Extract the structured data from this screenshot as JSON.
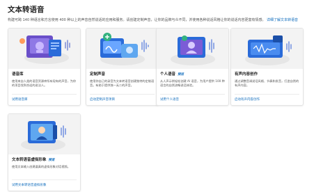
{
  "page": {
    "title": "文本转语音",
    "intro": "构建可跨 140 种语言和方言使用 400 种以上的声音自然说话的应用和服务。请创建定制声音，让你的品牌与众不同，并使用各种说话风格让你的说话内容更富有情感。",
    "intro_link": "详细了解文本转语音"
  },
  "cards": [
    {
      "title": "语音库",
      "badge": "",
      "desc": "使用来自人类的语音资源库所有现有的声音，为你的项目找到合适的说法人。",
      "link": "试用语音库",
      "icon": "voice-library-illustration",
      "accent": "#7b5cd6"
    },
    {
      "title": "定制声音",
      "badge": "",
      "desc": "使用你自己的录音为文本转语音创建独特的定制语音。有助于提供独一无二的声音。",
      "link": "启动定制声音项目",
      "icon": "custom-voice-illustration",
      "accent": "#2c8c6b"
    },
    {
      "title": "个人语音",
      "badge": "预览",
      "desc": "从人声示例轻松创建 AI 语音，为用户提供 100 种语言的自然流畅说话体验。",
      "link": "试用个人语音",
      "icon": "personal-voice-illustration",
      "accent": "#3b8fd8"
    },
    {
      "title": "有声内容创作",
      "badge": "",
      "desc": "通过调整音调说话风格、节奏和发音，打造自然的有声内容。",
      "link": "启动有声内容创作",
      "icon": "audio-content-creation-illustration",
      "accent": "#2a6bd9"
    },
    {
      "title": "文本转语音虚拟形象",
      "badge": "预览",
      "desc": "使用文本输入创建逼真的虚拟形象对话视频。",
      "link": "试用文本转语音虚拟形象",
      "icon": "avatar-illustration",
      "accent": "#3a7fe0"
    }
  ]
}
